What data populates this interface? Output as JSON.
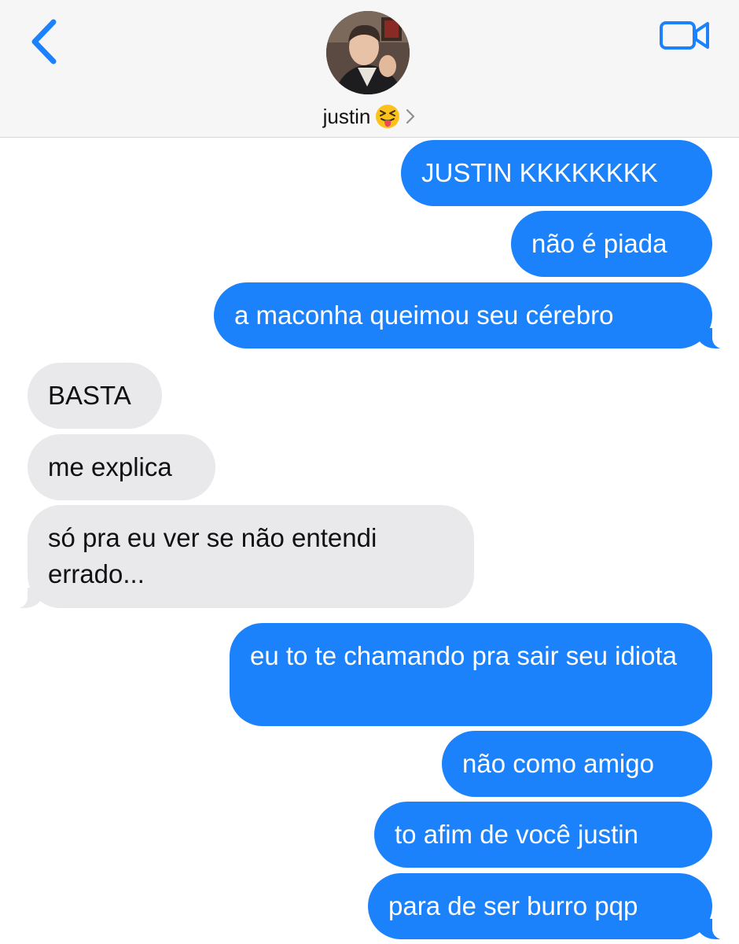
{
  "header": {
    "contact_name": "justin",
    "contact_emoji_icon": "squinting-face-with-tongue-icon",
    "chevron_icon": "chevron-right-icon",
    "back_icon": "chevron-left-icon",
    "video_icon": "video-camera-icon",
    "avatar": "contact-avatar-photo"
  },
  "colors": {
    "accent": "#1b82fb",
    "received_bubble": "#e9e9eb",
    "header_bg": "#f6f6f7"
  },
  "messages": [
    {
      "sender": "me",
      "text": "JUSTIN KKKKKKKK"
    },
    {
      "sender": "me",
      "text": "não é piada"
    },
    {
      "sender": "me",
      "text": "a maconha queimou seu cérebro"
    },
    {
      "sender": "them",
      "text": "BASTA"
    },
    {
      "sender": "them",
      "text": "me explica"
    },
    {
      "sender": "them",
      "text": "só pra eu ver se não entendi errado..."
    },
    {
      "sender": "me",
      "text": "eu to te chamando pra sair seu idiota"
    },
    {
      "sender": "me",
      "text": "não como amigo"
    },
    {
      "sender": "me",
      "text": "to afim de você justin"
    },
    {
      "sender": "me",
      "text": "para de ser burro pqp"
    }
  ]
}
